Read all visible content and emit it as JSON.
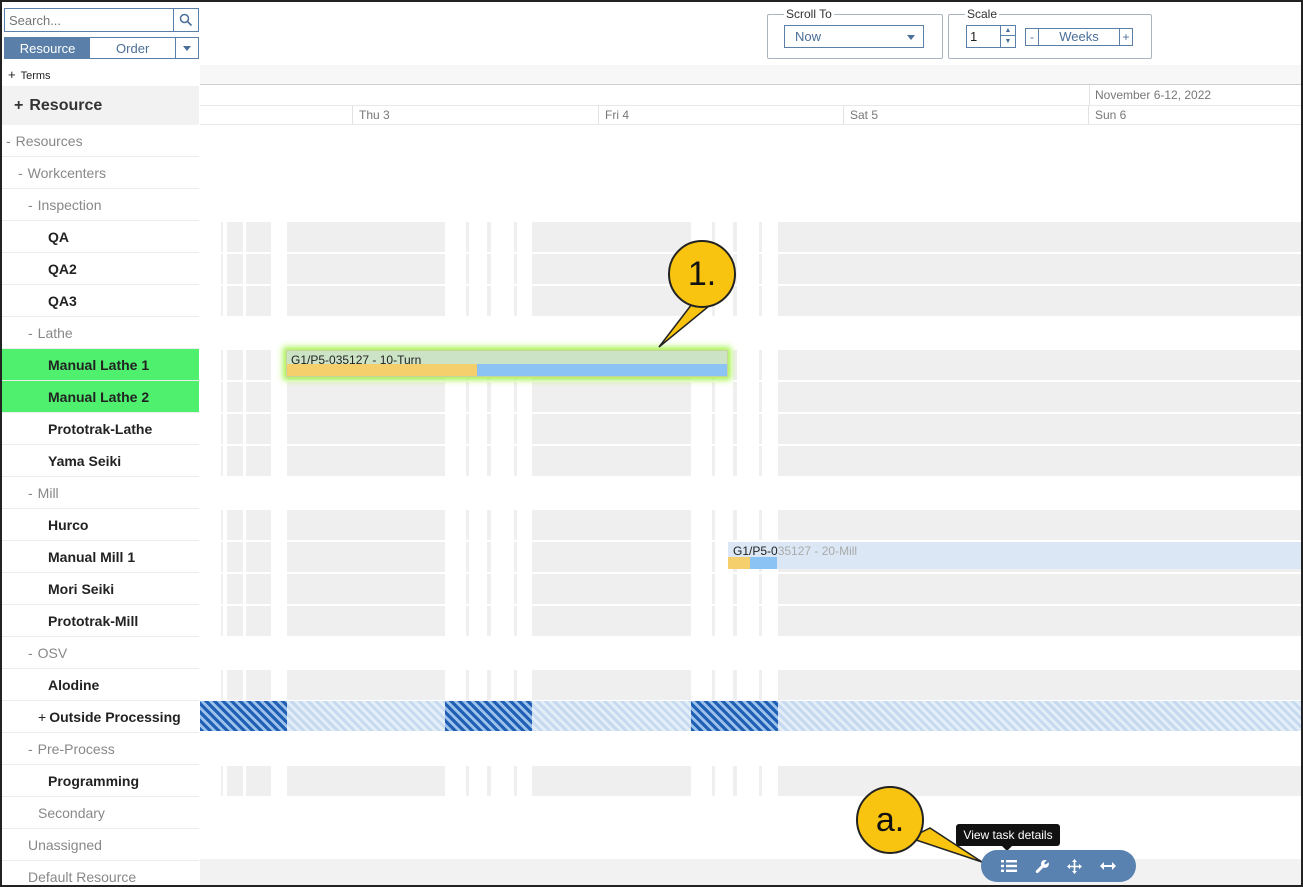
{
  "search": {
    "placeholder": "Search..."
  },
  "mode_toggle": {
    "resource": "Resource",
    "order": "Order"
  },
  "terms": {
    "toggle": "+",
    "label": "Terms"
  },
  "resource_header": {
    "toggle": "+",
    "label": "Resource"
  },
  "tree": [
    {
      "toggle": "-",
      "label": "Resources"
    },
    {
      "toggle": "-",
      "label": "Workcenters"
    },
    {
      "toggle": "-",
      "label": "Inspection"
    },
    {
      "label": "QA"
    },
    {
      "label": "QA2"
    },
    {
      "label": "QA3"
    },
    {
      "toggle": "-",
      "label": "Lathe"
    },
    {
      "label": "Manual Lathe 1"
    },
    {
      "label": "Manual Lathe 2"
    },
    {
      "label": "Prototrak-Lathe"
    },
    {
      "label": "Yama Seiki"
    },
    {
      "toggle": "-",
      "label": "Mill"
    },
    {
      "label": "Hurco"
    },
    {
      "label": "Manual Mill 1"
    },
    {
      "label": "Mori Seiki"
    },
    {
      "label": "Prototrak-Mill"
    },
    {
      "toggle": "-",
      "label": "OSV"
    },
    {
      "label": "Alodine"
    },
    {
      "toggle": "+",
      "label": "Outside Processing"
    },
    {
      "toggle": "-",
      "label": "Pre-Process"
    },
    {
      "label": "Programming"
    },
    {
      "label": "Secondary"
    },
    {
      "label": "Unassigned"
    },
    {
      "label": "Default Resource"
    }
  ],
  "scroll_to": {
    "legend": "Scroll To",
    "value": "Now"
  },
  "scale": {
    "legend": "Scale",
    "value": "1",
    "minus": "-",
    "unit": "Weeks",
    "plus": "+"
  },
  "timeline": {
    "week": "November 6-12, 2022",
    "days": [
      "Thu 3",
      "Fri 4",
      "Sat 5",
      "Sun 6"
    ]
  },
  "tasks": {
    "task1": "G1/P5-035127 - 10-Turn",
    "task2_visible": "G1/P5-0",
    "task2_faded": "35127 - 20-Mill"
  },
  "callouts": {
    "one": "1.",
    "a": "a."
  },
  "tooltip": "View task details",
  "float_tools": [
    "task-details-icon",
    "wrench-icon",
    "move-icon",
    "resize-horizontal-icon"
  ],
  "colors": {
    "accent": "#5a7fa8",
    "highlight": "#4ef06e",
    "callout": "#f8c40f",
    "progress_done": "#f5cf6b",
    "progress_remaining": "#8cc3f5"
  }
}
